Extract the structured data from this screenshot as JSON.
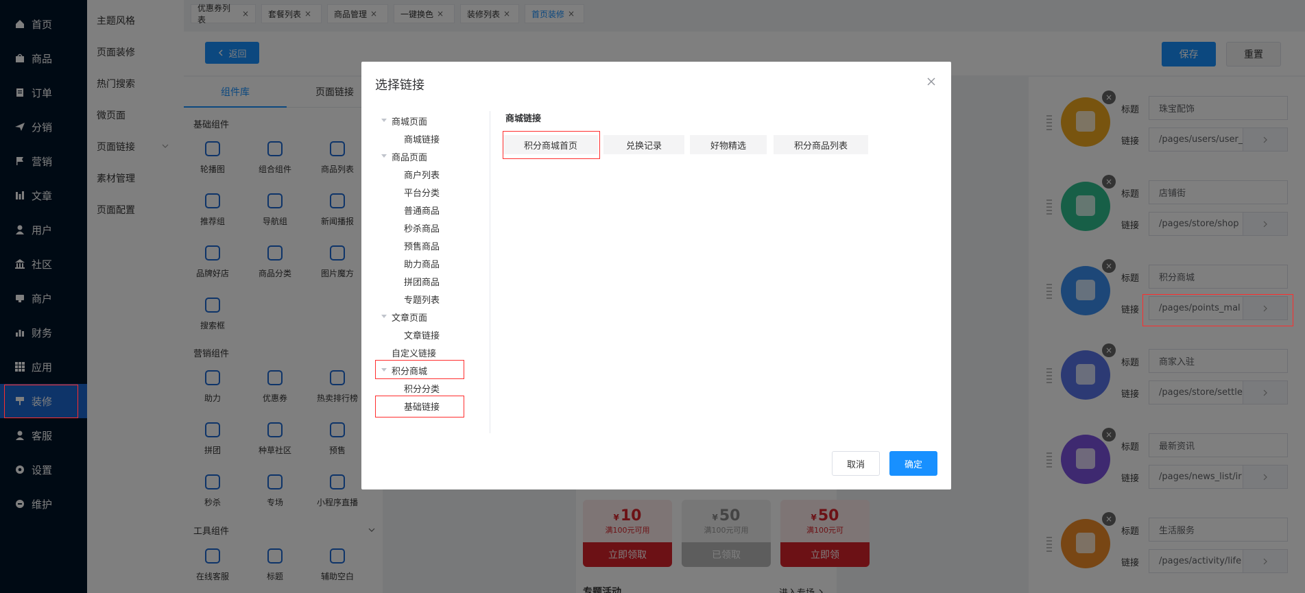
{
  "nav": {
    "items": [
      {
        "label": "首页",
        "icon": "home-icon"
      },
      {
        "label": "商品",
        "icon": "bag-icon"
      },
      {
        "label": "订单",
        "icon": "order-icon"
      },
      {
        "label": "分销",
        "icon": "send-icon"
      },
      {
        "label": "营销",
        "icon": "flag-icon"
      },
      {
        "label": "文章",
        "icon": "article-icon"
      },
      {
        "label": "用户",
        "icon": "user-icon"
      },
      {
        "label": "社区",
        "icon": "community-icon"
      },
      {
        "label": "商户",
        "icon": "merchant-icon"
      },
      {
        "label": "财务",
        "icon": "finance-icon"
      },
      {
        "label": "应用",
        "icon": "apps-icon"
      },
      {
        "label": "装修",
        "icon": "brush-icon"
      },
      {
        "label": "客服",
        "icon": "service-icon"
      },
      {
        "label": "设置",
        "icon": "gear-icon"
      },
      {
        "label": "维护",
        "icon": "maintain-icon"
      }
    ],
    "active_index": 11
  },
  "submenu": {
    "items": [
      "主题风格",
      "页面装修",
      "热门搜索",
      "微页面",
      "页面链接",
      "素材管理",
      "页面配置"
    ]
  },
  "tabs": [
    {
      "label": "优惠券列表"
    },
    {
      "label": "套餐列表"
    },
    {
      "label": "商品管理"
    },
    {
      "label": "一键换色"
    },
    {
      "label": "装修列表"
    },
    {
      "label": "首页装修"
    }
  ],
  "toolbar": {
    "back": "返回",
    "save": "保存",
    "reset": "重置"
  },
  "library": {
    "tab_components": "组件库",
    "tab_links": "页面链接",
    "basic_title": "基础组件",
    "basic": [
      "轮播图",
      "组合组件",
      "商品列表",
      "推荐组",
      "导航组",
      "新闻播报",
      "品牌好店",
      "商品分类",
      "图片魔方",
      "搜索框"
    ],
    "marketing_title": "营销组件",
    "marketing": [
      "助力",
      "优惠券",
      "热卖排行榜",
      "拼团",
      "种草社区",
      "预售",
      "秒杀",
      "专场",
      "小程序直播"
    ],
    "tools_title": "工具组件",
    "tools": [
      "在线客服",
      "标题",
      "辅助空白"
    ]
  },
  "config": {
    "title_label": "标题",
    "link_label": "链接",
    "rows": [
      {
        "title": "珠宝配饰",
        "link": "/pages/users/user_",
        "color": "#f0a91e",
        "icon": "diamond-icon"
      },
      {
        "title": "店铺街",
        "link": "/pages/store/shop",
        "color": "#2fbf8f",
        "icon": "badminton-icon"
      },
      {
        "title": "积分商城",
        "link": "/pages/points_mal",
        "color": "#3b8ff0",
        "icon": "shopping-bag-icon"
      },
      {
        "title": "商家入驻",
        "link": "/pages/store/settle",
        "color": "#5874e8",
        "icon": "store-icon"
      },
      {
        "title": "最新资讯",
        "link": "/pages/news_list/ir",
        "color": "#7d52e0",
        "icon": "news-icon"
      },
      {
        "title": "生活服务",
        "link": "/pages/activity/life",
        "color": "#f08c28",
        "icon": "gift-icon"
      }
    ]
  },
  "coupons": [
    {
      "amount": "10",
      "cond": "满100元可用",
      "action": "立即领取",
      "state": "active"
    },
    {
      "amount": "50",
      "cond": "满100元可用",
      "action": "已领取",
      "state": "used"
    },
    {
      "amount": "50",
      "cond": "满100元可",
      "action": "立即领",
      "state": "active"
    }
  ],
  "currency": "¥",
  "special": {
    "title": "专题活动",
    "more": "进入专场"
  },
  "dialog": {
    "title": "选择链接",
    "tree": [
      {
        "label": "商城页面",
        "level": 0,
        "caret": true
      },
      {
        "label": "商城链接",
        "level": 1
      },
      {
        "label": "商品页面",
        "level": 0,
        "caret": true
      },
      {
        "label": "商户列表",
        "level": 1
      },
      {
        "label": "平台分类",
        "level": 1
      },
      {
        "label": "普通商品",
        "level": 1
      },
      {
        "label": "秒杀商品",
        "level": 1
      },
      {
        "label": "预售商品",
        "level": 1
      },
      {
        "label": "助力商品",
        "level": 1
      },
      {
        "label": "拼团商品",
        "level": 1
      },
      {
        "label": "专题列表",
        "level": 1
      },
      {
        "label": "文章页面",
        "level": 0,
        "caret": true
      },
      {
        "label": "文章链接",
        "level": 1
      },
      {
        "label": "自定义链接",
        "level": 0,
        "caret": false
      },
      {
        "label": "积分商城",
        "level": 0,
        "caret": true
      },
      {
        "label": "积分分类",
        "level": 1
      },
      {
        "label": "基础链接",
        "level": 1
      }
    ],
    "section": "商城链接",
    "links": [
      "积分商城首页",
      "兑换记录",
      "好物精选",
      "积分商品列表"
    ],
    "cancel": "取消",
    "confirm": "确定"
  }
}
